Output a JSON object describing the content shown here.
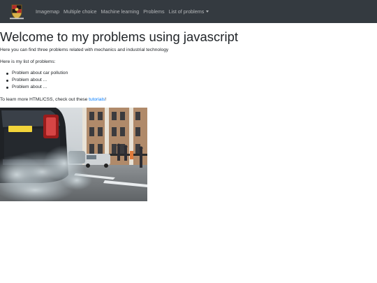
{
  "nav": {
    "items": [
      "Imagemap",
      "Multiple choice",
      "Machine learning",
      "Problems"
    ],
    "dropdown_label": "List of problems"
  },
  "main": {
    "title": "Welcome to my problems using javascript",
    "intro": "Here you can find three problems related with mechanics and industrial technology",
    "list_heading": "Here is my list of problems:",
    "problems": [
      "Problem about car pollution",
      "Problem about ...",
      "Problem about ..."
    ],
    "learn_prefix": "To learn more HTML/CSS, check out these ",
    "learn_link": "tutorials",
    "learn_suffix": "!"
  },
  "icons": {
    "brand": "crest-logo-icon",
    "dropdown": "caret-down-icon"
  },
  "colors": {
    "navbar": "#343a40",
    "link": "#007bff",
    "text": "#212529"
  }
}
